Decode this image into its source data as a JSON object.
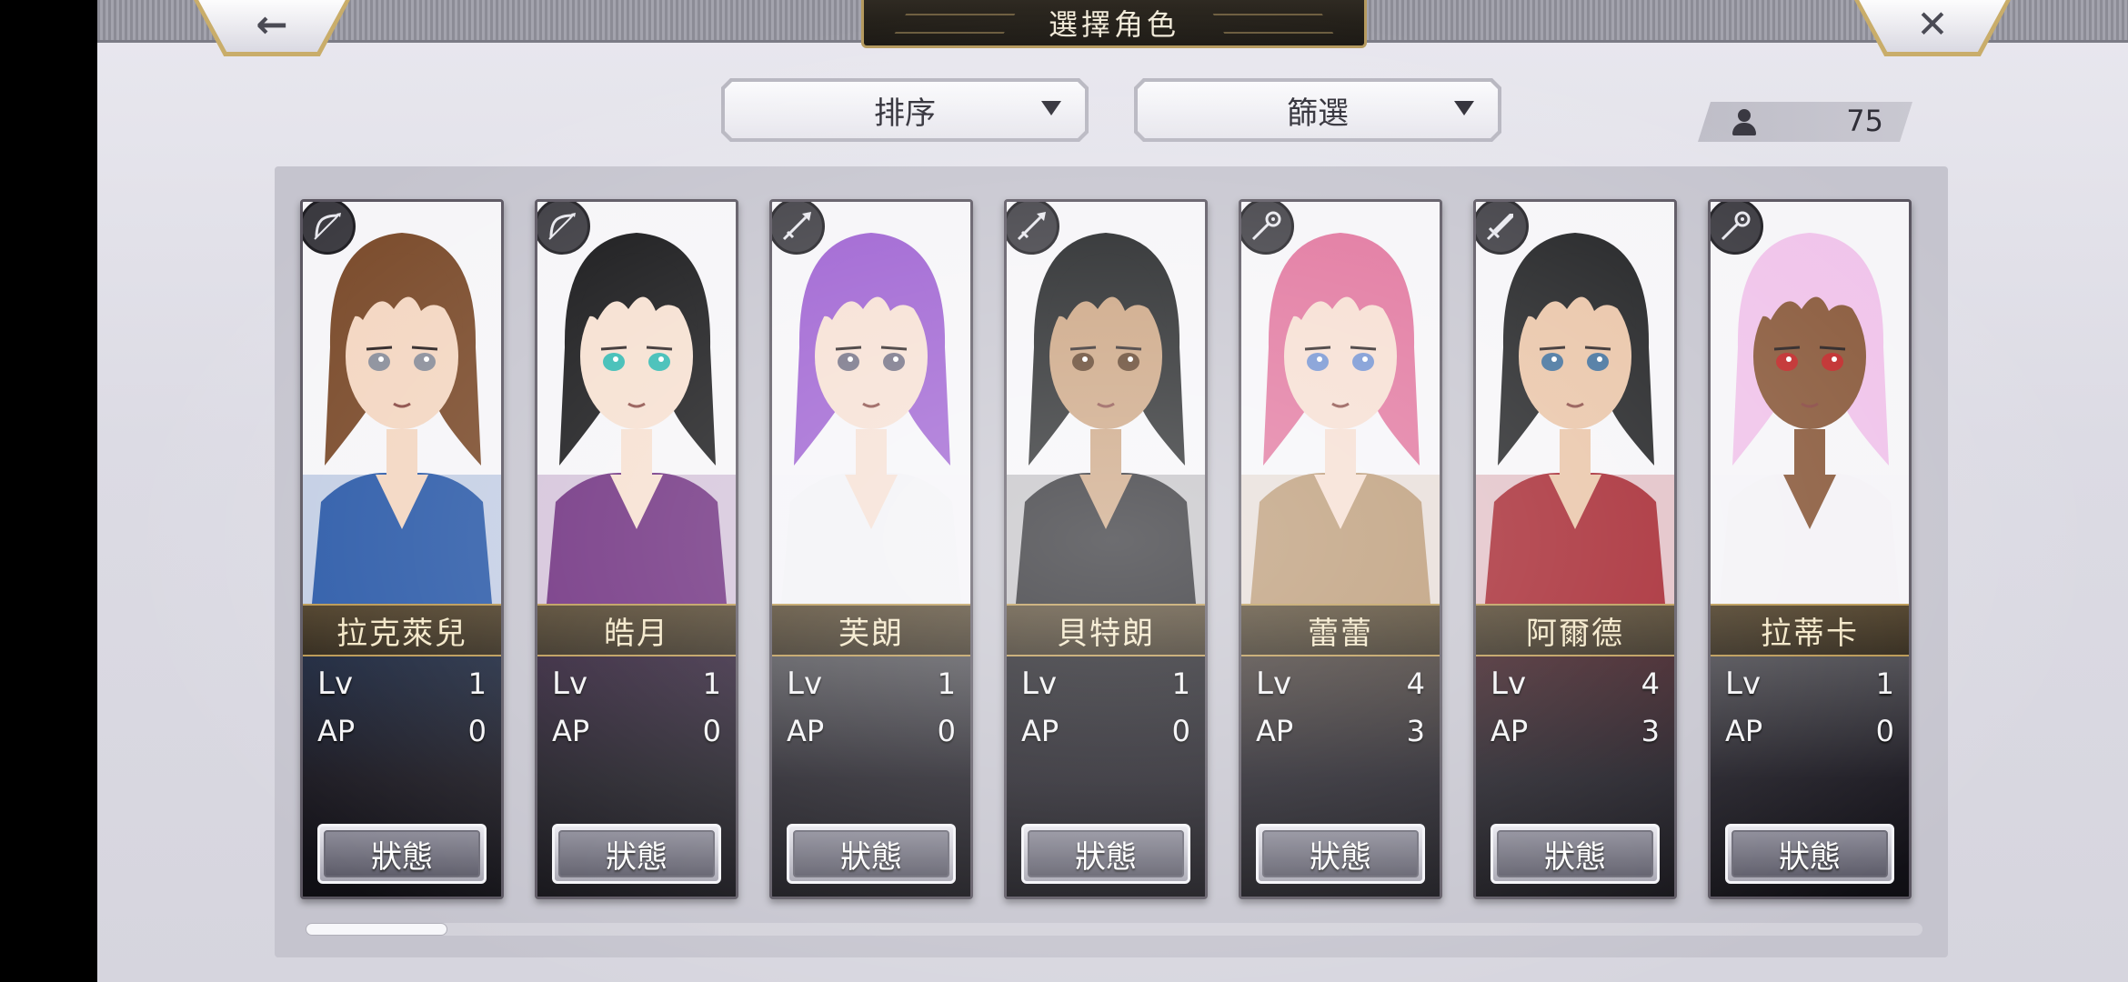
{
  "header": {
    "title": "選擇角色",
    "back_icon": "back-arrow-icon",
    "close_icon": "close-icon",
    "back_glyph": "←",
    "close_glyph": "✕"
  },
  "controls": {
    "sort_label": "排序",
    "filter_label": "篩選",
    "character_count": "75"
  },
  "colors": {
    "gold": "#b9964f",
    "panel": "#c5c4ce"
  },
  "characters": [
    {
      "name": "拉克萊兒",
      "lv_label": "Lv",
      "lv": "1",
      "ap_label": "AP",
      "ap": "0",
      "class_icon": "bow-icon",
      "status_label": "狀態",
      "hair": "#7a4a2a",
      "outfit": "#2b5aa8",
      "skin": "#f3d6c1",
      "eye": "#8a8e9a"
    },
    {
      "name": "皓月",
      "lv_label": "Lv",
      "lv": "1",
      "ap_label": "AP",
      "ap": "0",
      "class_icon": "bow-icon",
      "status_label": "狀態",
      "hair": "#121214",
      "outfit": "#6b2a7c",
      "skin": "#f6dfcf",
      "eye": "#2fb8b0"
    },
    {
      "name": "芙朗",
      "lv_label": "Lv",
      "lv": "1",
      "ap_label": "AP",
      "ap": "0",
      "class_icon": "spear-icon",
      "status_label": "狀態",
      "hair": "#9a5bd0",
      "outfit": "#f2f2f6",
      "skin": "#f6dfd2",
      "eye": "#6f6c80"
    },
    {
      "name": "貝特朗",
      "lv_label": "Lv",
      "lv": "1",
      "ap_label": "AP",
      "ap": "0",
      "class_icon": "spear-icon",
      "status_label": "狀態",
      "hair": "#1a1c1e",
      "outfit": "#1f1f24",
      "skin": "#c9a07c",
      "eye": "#5a3a22"
    },
    {
      "name": "蕾蕾",
      "lv_label": "Lv",
      "lv": "4",
      "ap_label": "AP",
      "ap": "3",
      "class_icon": "staff-icon",
      "status_label": "狀態",
      "hair": "#e0709a",
      "outfit": "#b8956f",
      "skin": "#f6ddd0",
      "eye": "#6f8fd0"
    },
    {
      "name": "阿爾德",
      "lv_label": "Lv",
      "lv": "4",
      "ap_label": "AP",
      "ap": "3",
      "class_icon": "sword-icon",
      "status_label": "狀態",
      "hair": "#1b1c1e",
      "outfit": "#a3202a",
      "skin": "#e9c3a5",
      "eye": "#3e6e9a"
    },
    {
      "name": "拉蒂卡",
      "lv_label": "Lv",
      "lv": "1",
      "ap_label": "AP",
      "ap": "0",
      "class_icon": "staff-icon",
      "status_label": "狀態",
      "hair": "#f0c3ea",
      "outfit": "#f4f2f6",
      "skin": "#8a5a3c",
      "eye": "#c02a2a"
    }
  ],
  "scroll": {
    "position_fraction": 0.0
  }
}
